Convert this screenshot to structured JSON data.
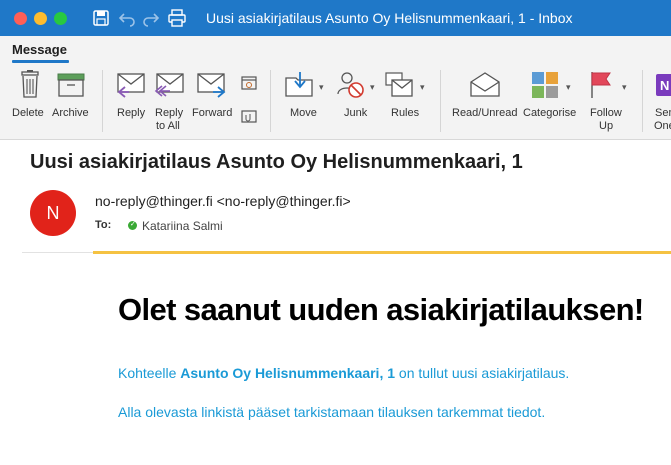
{
  "window": {
    "title": "Uusi asiakirjatilaus Asunto Oy Helisnummenkaari, 1 - Inbox"
  },
  "tabs": {
    "active": "Message"
  },
  "ribbon": {
    "delete": "Delete",
    "archive": "Archive",
    "reply": "Reply",
    "reply_all_1": "Reply",
    "reply_all_2": "to All",
    "forward": "Forward",
    "move": "Move",
    "junk": "Junk",
    "rules": "Rules",
    "read_unread": "Read/Unread",
    "categorise": "Categorise",
    "follow_up_1": "Follow",
    "follow_up_2": "Up",
    "send_to_onenote_1": "Sen",
    "send_to_onenote_2": "One"
  },
  "message": {
    "subject": "Uusi asiakirjatilaus Asunto Oy Helisnummenkaari, 1",
    "avatar_initial": "N",
    "sender": "no-reply@thinger.fi <no-reply@thinger.fi>",
    "to_label": "To:",
    "to_name": "Katariina Salmi"
  },
  "body": {
    "headline": "Olet saanut uuden asiakirjatilauksen!",
    "para1_prefix": "Kohteelle ",
    "para1_bold": "Asunto Oy Helisnummenkaari, 1",
    "para1_suffix": " on tullut uusi asiakirjatilaus.",
    "para2": "Alla olevasta linkistä pääset tarkistamaan tilauksen tarkemmat tiedot."
  },
  "colors": {
    "titlebar": "#1f78c8",
    "avatar": "#e1231a",
    "link_text": "#1a9ad6",
    "accent_bar": "#f5c242"
  }
}
